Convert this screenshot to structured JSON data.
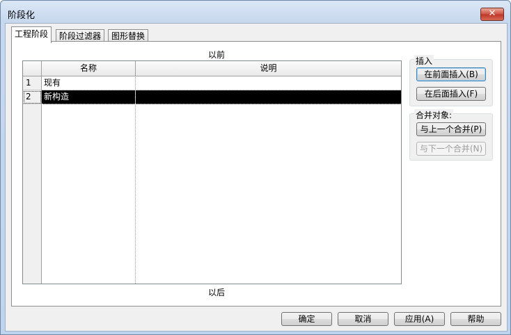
{
  "window": {
    "title": "阶段化",
    "close_label": "✕"
  },
  "tabs": [
    {
      "label": "工程阶段",
      "active": true
    },
    {
      "label": "阶段过滤器",
      "active": false
    },
    {
      "label": "图形替换",
      "active": false
    }
  ],
  "panel": {
    "before_label": "以前",
    "after_label": "以后",
    "table": {
      "columns": [
        "名称",
        "说明"
      ],
      "rows": [
        {
          "num": "1",
          "name": "现有",
          "desc": "",
          "selected": false
        },
        {
          "num": "2",
          "name": "新构造",
          "desc": "",
          "selected": true
        }
      ]
    }
  },
  "insert_group": {
    "label": "插入",
    "before_button": "在前面插入(B)",
    "after_button": "在后面插入(F)"
  },
  "merge_group": {
    "label": "合并对象:",
    "prev_button": "与上一个合并(P)",
    "next_button": "与下一个合并(N)"
  },
  "footer": {
    "ok": "确定",
    "cancel": "取消",
    "apply": "应用(A)",
    "help": "帮助"
  }
}
